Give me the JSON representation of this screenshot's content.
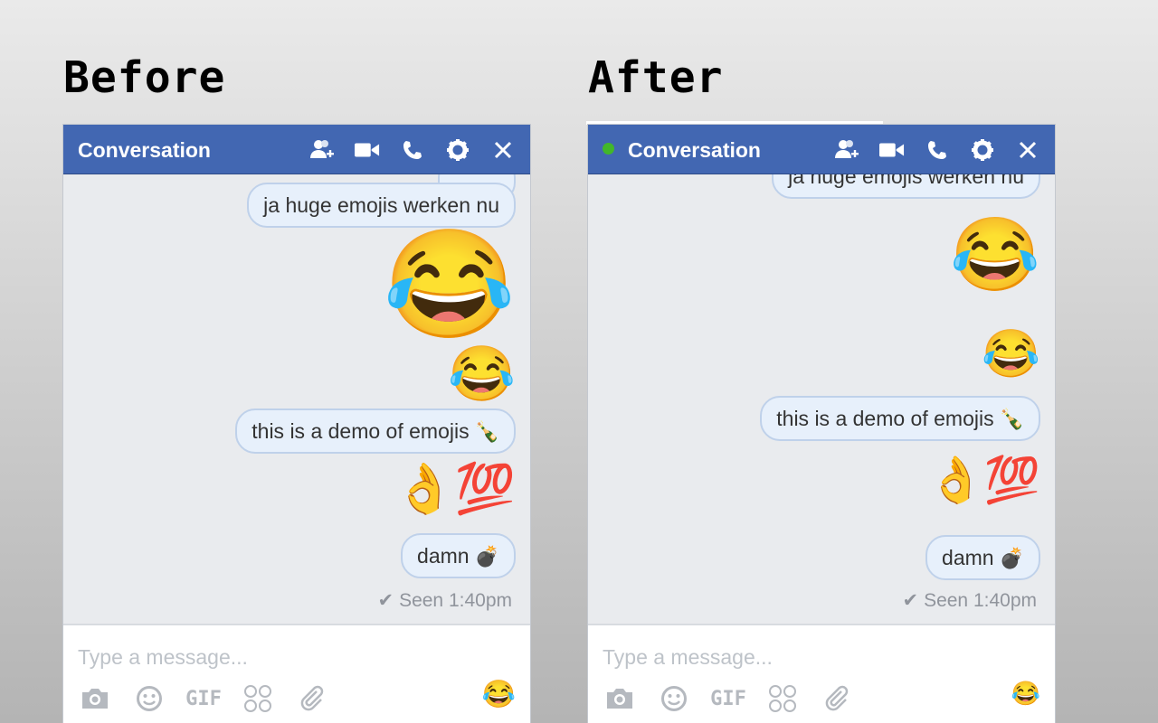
{
  "labels": {
    "before": "Before",
    "after": "After"
  },
  "colors": {
    "header": "#4267b2",
    "online": "#42b72a",
    "bubble_bg": "#e7f0fb",
    "bubble_border": "#bfd1ea"
  },
  "before": {
    "title": "Conversation",
    "header_icons": [
      "add-people-icon",
      "video-icon",
      "phone-icon",
      "gear-icon",
      "close-icon"
    ],
    "messages": {
      "m1": "ja huge emojis werken nu",
      "big_emoji": "😂",
      "small_emoji": "😂",
      "m2": "this is a demo of emojis",
      "m2_emoji": "🍾",
      "ok_100": "👌💯",
      "m3": "damn",
      "m3_emoji": "💣"
    },
    "seen": "Seen 1:40pm",
    "placeholder": "Type a message...",
    "gif": "GIF",
    "emoji_button": "😂"
  },
  "after": {
    "title": "Conversation",
    "online": true,
    "header_icons": [
      "add-people-icon",
      "video-icon",
      "phone-icon",
      "gear-icon",
      "close-icon"
    ],
    "messages": {
      "m1": "ja huge emojis werken nu",
      "big_emoji": "😂",
      "small_emoji": "😂",
      "m2": "this is a demo of emojis",
      "m2_emoji": "🍾",
      "ok_100": "👌💯",
      "m3": "damn",
      "m3_emoji": "💣"
    },
    "seen": "Seen 1:40pm",
    "placeholder": "Type a message...",
    "gif": "GIF",
    "emoji_button": "😂"
  }
}
